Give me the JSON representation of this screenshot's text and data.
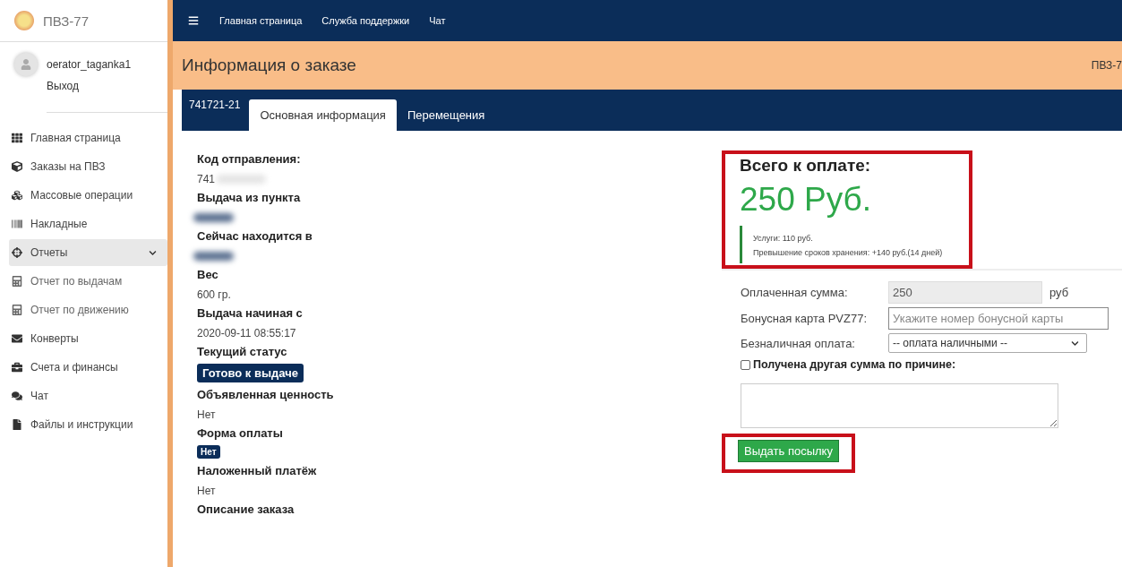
{
  "sidebar": {
    "brand": "ПВЗ-77",
    "user": "oerator_taganka1",
    "logout": "Выход",
    "items": [
      {
        "label": "Главная страница",
        "selected": false
      },
      {
        "label": "Заказы на ПВЗ",
        "selected": false
      },
      {
        "label": "Массовые операции",
        "selected": false
      },
      {
        "label": "Накладные",
        "selected": false
      },
      {
        "label": "Отчеты",
        "selected": true,
        "expanded": true,
        "children": [
          {
            "label": "Отчет по выдачам"
          },
          {
            "label": "Отчет по движению"
          }
        ]
      },
      {
        "label": "Конверты",
        "selected": false
      },
      {
        "label": "Счета и финансы",
        "selected": false
      },
      {
        "label": "Чат",
        "selected": false
      },
      {
        "label": "Файлы и инструкции",
        "selected": false
      }
    ]
  },
  "navbar": {
    "links": [
      "Главная страница",
      "Служба поддержки",
      "Чат"
    ]
  },
  "header": {
    "title": "Информация о заказе",
    "right": "ПВЗ-7"
  },
  "order_tab_label": "741721-21",
  "tabs": [
    {
      "label": "Основная информация",
      "selected": true
    },
    {
      "label": "Перемещения",
      "selected": false
    }
  ],
  "fields": [
    {
      "label": "Код отправления:",
      "kind": "text",
      "value": "741",
      "redacted": true
    },
    {
      "label": "Выдача из пункта",
      "kind": "hidden"
    },
    {
      "label": "Сейчас находится в",
      "kind": "hidden"
    },
    {
      "label": "Вес",
      "kind": "text",
      "value": "600 гр."
    },
    {
      "label": "Выдача начиная с",
      "kind": "text",
      "value": "2020-09-11 08:55:17"
    },
    {
      "label": "Текущий статус",
      "kind": "badge",
      "value": "Готово к выдаче"
    },
    {
      "label": "Объявленная ценность",
      "kind": "text",
      "value": "Нет"
    },
    {
      "label": "Форма оплаты",
      "kind": "small_badge",
      "value": "Нет"
    },
    {
      "label": "Наложенный платёж",
      "kind": "text",
      "value": "Нет"
    },
    {
      "label": "Описание заказа",
      "kind": "label_only"
    }
  ],
  "total": {
    "title": "Всего к оплате:",
    "amount": "250 Руб.",
    "details": [
      "Услуги: 110 руб.",
      "Превышение сроков хранения: +140 руб.(14 дней)"
    ],
    "highlighted": true
  },
  "form": {
    "paid_label": "Оплаченная сумма:",
    "paid_value": "250",
    "paid_unit": "руб",
    "bonus_label": "Бонусная карта PVZ77:",
    "bonus_placeholder": "Укажите номер бонусной карты",
    "cashless_label": "Безналичная оплата:",
    "cashless_value": "-- оплата наличными --",
    "other_sum_label": "Получена другая сумма по причине:",
    "other_sum_checked": false,
    "submit": "Выдать посылку",
    "submit_highlighted": true
  }
}
